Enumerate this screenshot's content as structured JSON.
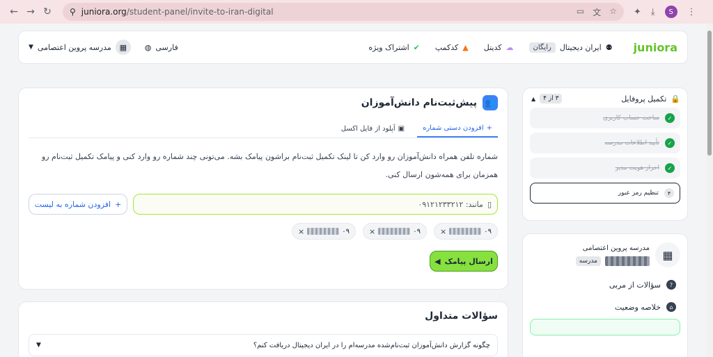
{
  "browser": {
    "url_host": "juniora.org",
    "url_path": "/student-panel/invite-to-iran-digital",
    "avatar_letter": "S"
  },
  "topbar": {
    "logo": "juniora",
    "menu": [
      {
        "label": "ایران دیجیتال",
        "badge": "رایگان"
      },
      {
        "label": "کدیتل"
      },
      {
        "label": "کدکمپ"
      },
      {
        "label": "اشتراک ویژه"
      }
    ],
    "language": "فارسی",
    "school": "مدرسه پروین اعتصامی"
  },
  "main": {
    "title": "پیش‌ثبت‌نام دانش‌آموزان",
    "tabs": [
      {
        "label": "افزودن دستی شماره",
        "active": true
      },
      {
        "label": "آپلود از فایل اکسل",
        "active": false
      }
    ],
    "description": "شماره تلفن همراه دانش‌آموزان رو وارد کن تا لینک تکمیل ثبت‌نام براشون پیامک بشه. می‌تونی چند شماره رو وارد کنی و پیامک تکمیل ثبت‌نام رو همزمان برای همه‌شون ارسال کنی.",
    "phone_placeholder": "مانند: ۰۹۱۲۱۲۳۳۲۱۲",
    "add_button": "افزودن شماره به لیست",
    "chips": [
      "۰۹",
      "۰۹",
      "۰۹"
    ],
    "send_button": "ارسال پیامک"
  },
  "faq": {
    "title": "سؤالات متداول",
    "items": [
      "چگونه گزارش دانش‌آموزان ثبت‌نام‌شده مدرسه‌ام را در ایران دیجیتال دریافت کنم؟"
    ]
  },
  "profile": {
    "title": "تکمیل پروفایل",
    "progress": "۳ از ۴",
    "steps": [
      {
        "label": "ساخت حساب کاربری",
        "done": true
      },
      {
        "label": "تأیید اطلاعات مدرسه",
        "done": true
      },
      {
        "label": "احراز هویت مدیر",
        "done": true
      },
      {
        "label": "تنظیم رمز عبور",
        "done": false,
        "num": "۴"
      }
    ]
  },
  "school_card": {
    "name": "مدرسه پروین اعتصامی",
    "type_badge": "مدرسه",
    "links": [
      "سؤالات از مربی",
      "خلاصه وضعیت"
    ]
  }
}
